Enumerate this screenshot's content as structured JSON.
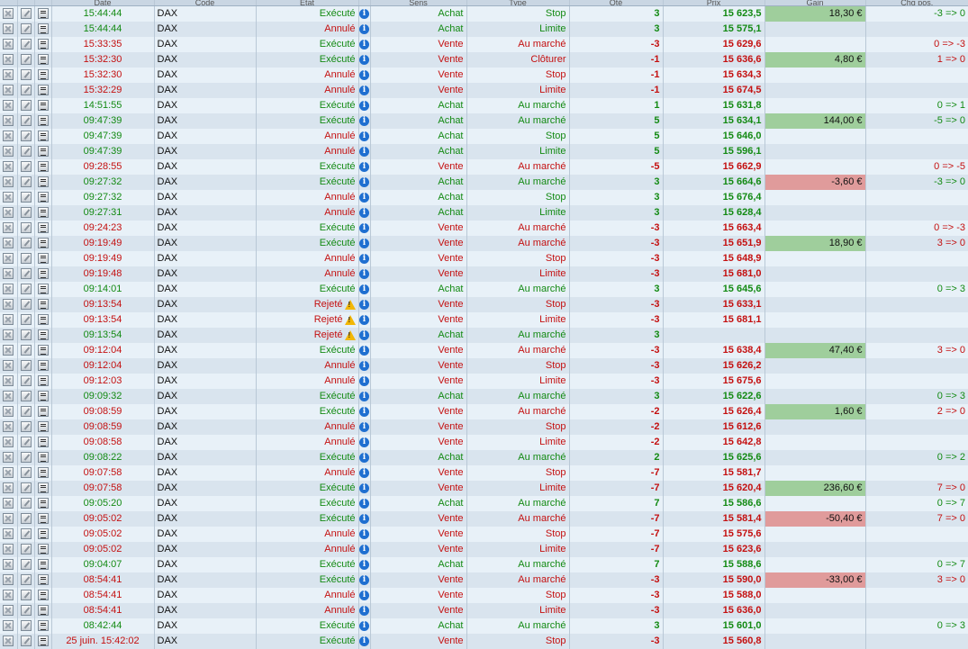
{
  "columns": [
    "Date",
    "Code",
    "Etat",
    "Sens",
    "Type",
    "Qté",
    "Prix",
    "Gain",
    "Chg pos."
  ],
  "colors": {
    "green": "#138a13",
    "red": "#c41010",
    "gain_pos": "#9fce9c",
    "gain_neg": "#e09b9b",
    "info": "#1f6fd0",
    "warning": "#f2b705"
  },
  "icons": [
    "cancel-order-icon",
    "edit-order-icon",
    "details-icon",
    "info-icon",
    "warning-icon"
  ],
  "rows": [
    {
      "time": "15:44:44",
      "code": "DAX",
      "etat": "Exécuté",
      "sens": "Achat",
      "type": "Stop",
      "qty": "3",
      "prix": "15 623,5",
      "gain": "18,30 €",
      "chg": "-3 => 0"
    },
    {
      "time": "15:44:44",
      "code": "DAX",
      "etat": "Annulé",
      "sens": "Achat",
      "type": "Limite",
      "qty": "3",
      "prix": "15 575,1",
      "gain": "",
      "chg": ""
    },
    {
      "time": "15:33:35",
      "code": "DAX",
      "etat": "Exécuté",
      "sens": "Vente",
      "type": "Au marché",
      "qty": "-3",
      "prix": "15 629,6",
      "gain": "",
      "chg": "0 => -3"
    },
    {
      "time": "15:32:30",
      "code": "DAX",
      "etat": "Exécuté",
      "sens": "Vente",
      "type": "Clôturer",
      "qty": "-1",
      "prix": "15 636,6",
      "gain": "4,80 €",
      "chg": "1 => 0"
    },
    {
      "time": "15:32:30",
      "code": "DAX",
      "etat": "Annulé",
      "sens": "Vente",
      "type": "Stop",
      "qty": "-1",
      "prix": "15 634,3",
      "gain": "",
      "chg": ""
    },
    {
      "time": "15:32:29",
      "code": "DAX",
      "etat": "Annulé",
      "sens": "Vente",
      "type": "Limite",
      "qty": "-1",
      "prix": "15 674,5",
      "gain": "",
      "chg": ""
    },
    {
      "time": "14:51:55",
      "code": "DAX",
      "etat": "Exécuté",
      "sens": "Achat",
      "type": "Au marché",
      "qty": "1",
      "prix": "15 631,8",
      "gain": "",
      "chg": "0 => 1"
    },
    {
      "time": "09:47:39",
      "code": "DAX",
      "etat": "Exécuté",
      "sens": "Achat",
      "type": "Au marché",
      "qty": "5",
      "prix": "15 634,1",
      "gain": "144,00 €",
      "chg": "-5 => 0"
    },
    {
      "time": "09:47:39",
      "code": "DAX",
      "etat": "Annulé",
      "sens": "Achat",
      "type": "Stop",
      "qty": "5",
      "prix": "15 646,0",
      "gain": "",
      "chg": ""
    },
    {
      "time": "09:47:39",
      "code": "DAX",
      "etat": "Annulé",
      "sens": "Achat",
      "type": "Limite",
      "qty": "5",
      "prix": "15 596,1",
      "gain": "",
      "chg": ""
    },
    {
      "time": "09:28:55",
      "code": "DAX",
      "etat": "Exécuté",
      "sens": "Vente",
      "type": "Au marché",
      "qty": "-5",
      "prix": "15 662,9",
      "gain": "",
      "chg": "0 => -5"
    },
    {
      "time": "09:27:32",
      "code": "DAX",
      "etat": "Exécuté",
      "sens": "Achat",
      "type": "Au marché",
      "qty": "3",
      "prix": "15 664,6",
      "gain": "-3,60 €",
      "chg": "-3 => 0"
    },
    {
      "time": "09:27:32",
      "code": "DAX",
      "etat": "Annulé",
      "sens": "Achat",
      "type": "Stop",
      "qty": "3",
      "prix": "15 676,4",
      "gain": "",
      "chg": ""
    },
    {
      "time": "09:27:31",
      "code": "DAX",
      "etat": "Annulé",
      "sens": "Achat",
      "type": "Limite",
      "qty": "3",
      "prix": "15 628,4",
      "gain": "",
      "chg": ""
    },
    {
      "time": "09:24:23",
      "code": "DAX",
      "etat": "Exécuté",
      "sens": "Vente",
      "type": "Au marché",
      "qty": "-3",
      "prix": "15 663,4",
      "gain": "",
      "chg": "0 => -3"
    },
    {
      "time": "09:19:49",
      "code": "DAX",
      "etat": "Exécuté",
      "sens": "Vente",
      "type": "Au marché",
      "qty": "-3",
      "prix": "15 651,9",
      "gain": "18,90 €",
      "chg": "3 => 0"
    },
    {
      "time": "09:19:49",
      "code": "DAX",
      "etat": "Annulé",
      "sens": "Vente",
      "type": "Stop",
      "qty": "-3",
      "prix": "15 648,9",
      "gain": "",
      "chg": ""
    },
    {
      "time": "09:19:48",
      "code": "DAX",
      "etat": "Annulé",
      "sens": "Vente",
      "type": "Limite",
      "qty": "-3",
      "prix": "15 681,0",
      "gain": "",
      "chg": ""
    },
    {
      "time": "09:14:01",
      "code": "DAX",
      "etat": "Exécuté",
      "sens": "Achat",
      "type": "Au marché",
      "qty": "3",
      "prix": "15 645,6",
      "gain": "",
      "chg": "0 => 3"
    },
    {
      "time": "09:13:54",
      "code": "DAX",
      "etat": "Rejeté",
      "sens": "Vente",
      "type": "Stop",
      "qty": "-3",
      "prix": "15 633,1",
      "gain": "",
      "chg": ""
    },
    {
      "time": "09:13:54",
      "code": "DAX",
      "etat": "Rejeté",
      "sens": "Vente",
      "type": "Limite",
      "qty": "-3",
      "prix": "15 681,1",
      "gain": "",
      "chg": ""
    },
    {
      "time": "09:13:54",
      "code": "DAX",
      "etat": "Rejeté",
      "sens": "Achat",
      "type": "Au marché",
      "qty": "3",
      "prix": "",
      "gain": "",
      "chg": ""
    },
    {
      "time": "09:12:04",
      "code": "DAX",
      "etat": "Exécuté",
      "sens": "Vente",
      "type": "Au marché",
      "qty": "-3",
      "prix": "15 638,4",
      "gain": "47,40 €",
      "chg": "3 => 0"
    },
    {
      "time": "09:12:04",
      "code": "DAX",
      "etat": "Annulé",
      "sens": "Vente",
      "type": "Stop",
      "qty": "-3",
      "prix": "15 626,2",
      "gain": "",
      "chg": ""
    },
    {
      "time": "09:12:03",
      "code": "DAX",
      "etat": "Annulé",
      "sens": "Vente",
      "type": "Limite",
      "qty": "-3",
      "prix": "15 675,6",
      "gain": "",
      "chg": ""
    },
    {
      "time": "09:09:32",
      "code": "DAX",
      "etat": "Exécuté",
      "sens": "Achat",
      "type": "Au marché",
      "qty": "3",
      "prix": "15 622,6",
      "gain": "",
      "chg": "0 => 3"
    },
    {
      "time": "09:08:59",
      "code": "DAX",
      "etat": "Exécuté",
      "sens": "Vente",
      "type": "Au marché",
      "qty": "-2",
      "prix": "15 626,4",
      "gain": "1,60 €",
      "chg": "2 => 0"
    },
    {
      "time": "09:08:59",
      "code": "DAX",
      "etat": "Annulé",
      "sens": "Vente",
      "type": "Stop",
      "qty": "-2",
      "prix": "15 612,6",
      "gain": "",
      "chg": ""
    },
    {
      "time": "09:08:58",
      "code": "DAX",
      "etat": "Annulé",
      "sens": "Vente",
      "type": "Limite",
      "qty": "-2",
      "prix": "15 642,8",
      "gain": "",
      "chg": ""
    },
    {
      "time": "09:08:22",
      "code": "DAX",
      "etat": "Exécuté",
      "sens": "Achat",
      "type": "Au marché",
      "qty": "2",
      "prix": "15 625,6",
      "gain": "",
      "chg": "0 => 2"
    },
    {
      "time": "09:07:58",
      "code": "DAX",
      "etat": "Annulé",
      "sens": "Vente",
      "type": "Stop",
      "qty": "-7",
      "prix": "15 581,7",
      "gain": "",
      "chg": ""
    },
    {
      "time": "09:07:58",
      "code": "DAX",
      "etat": "Exécuté",
      "sens": "Vente",
      "type": "Limite",
      "qty": "-7",
      "prix": "15 620,4",
      "gain": "236,60 €",
      "chg": "7 => 0"
    },
    {
      "time": "09:05:20",
      "code": "DAX",
      "etat": "Exécuté",
      "sens": "Achat",
      "type": "Au marché",
      "qty": "7",
      "prix": "15 586,6",
      "gain": "",
      "chg": "0 => 7"
    },
    {
      "time": "09:05:02",
      "code": "DAX",
      "etat": "Exécuté",
      "sens": "Vente",
      "type": "Au marché",
      "qty": "-7",
      "prix": "15 581,4",
      "gain": "-50,40 €",
      "chg": "7 => 0"
    },
    {
      "time": "09:05:02",
      "code": "DAX",
      "etat": "Annulé",
      "sens": "Vente",
      "type": "Stop",
      "qty": "-7",
      "prix": "15 575,6",
      "gain": "",
      "chg": ""
    },
    {
      "time": "09:05:02",
      "code": "DAX",
      "etat": "Annulé",
      "sens": "Vente",
      "type": "Limite",
      "qty": "-7",
      "prix": "15 623,6",
      "gain": "",
      "chg": ""
    },
    {
      "time": "09:04:07",
      "code": "DAX",
      "etat": "Exécuté",
      "sens": "Achat",
      "type": "Au marché",
      "qty": "7",
      "prix": "15 588,6",
      "gain": "",
      "chg": "0 => 7"
    },
    {
      "time": "08:54:41",
      "code": "DAX",
      "etat": "Exécuté",
      "sens": "Vente",
      "type": "Au marché",
      "qty": "-3",
      "prix": "15 590,0",
      "gain": "-33,00 €",
      "chg": "3 => 0"
    },
    {
      "time": "08:54:41",
      "code": "DAX",
      "etat": "Annulé",
      "sens": "Vente",
      "type": "Stop",
      "qty": "-3",
      "prix": "15 588,0",
      "gain": "",
      "chg": ""
    },
    {
      "time": "08:54:41",
      "code": "DAX",
      "etat": "Annulé",
      "sens": "Vente",
      "type": "Limite",
      "qty": "-3",
      "prix": "15 636,0",
      "gain": "",
      "chg": ""
    },
    {
      "time": "08:42:44",
      "code": "DAX",
      "etat": "Exécuté",
      "sens": "Achat",
      "type": "Au marché",
      "qty": "3",
      "prix": "15 601,0",
      "gain": "",
      "chg": "0 => 3"
    },
    {
      "time": "25 juin. 15:42:02",
      "code": "DAX",
      "etat": "Exécuté",
      "sens": "Vente",
      "type": "Stop",
      "qty": "-3",
      "prix": "15 560,8",
      "gain": "",
      "chg": ""
    }
  ]
}
